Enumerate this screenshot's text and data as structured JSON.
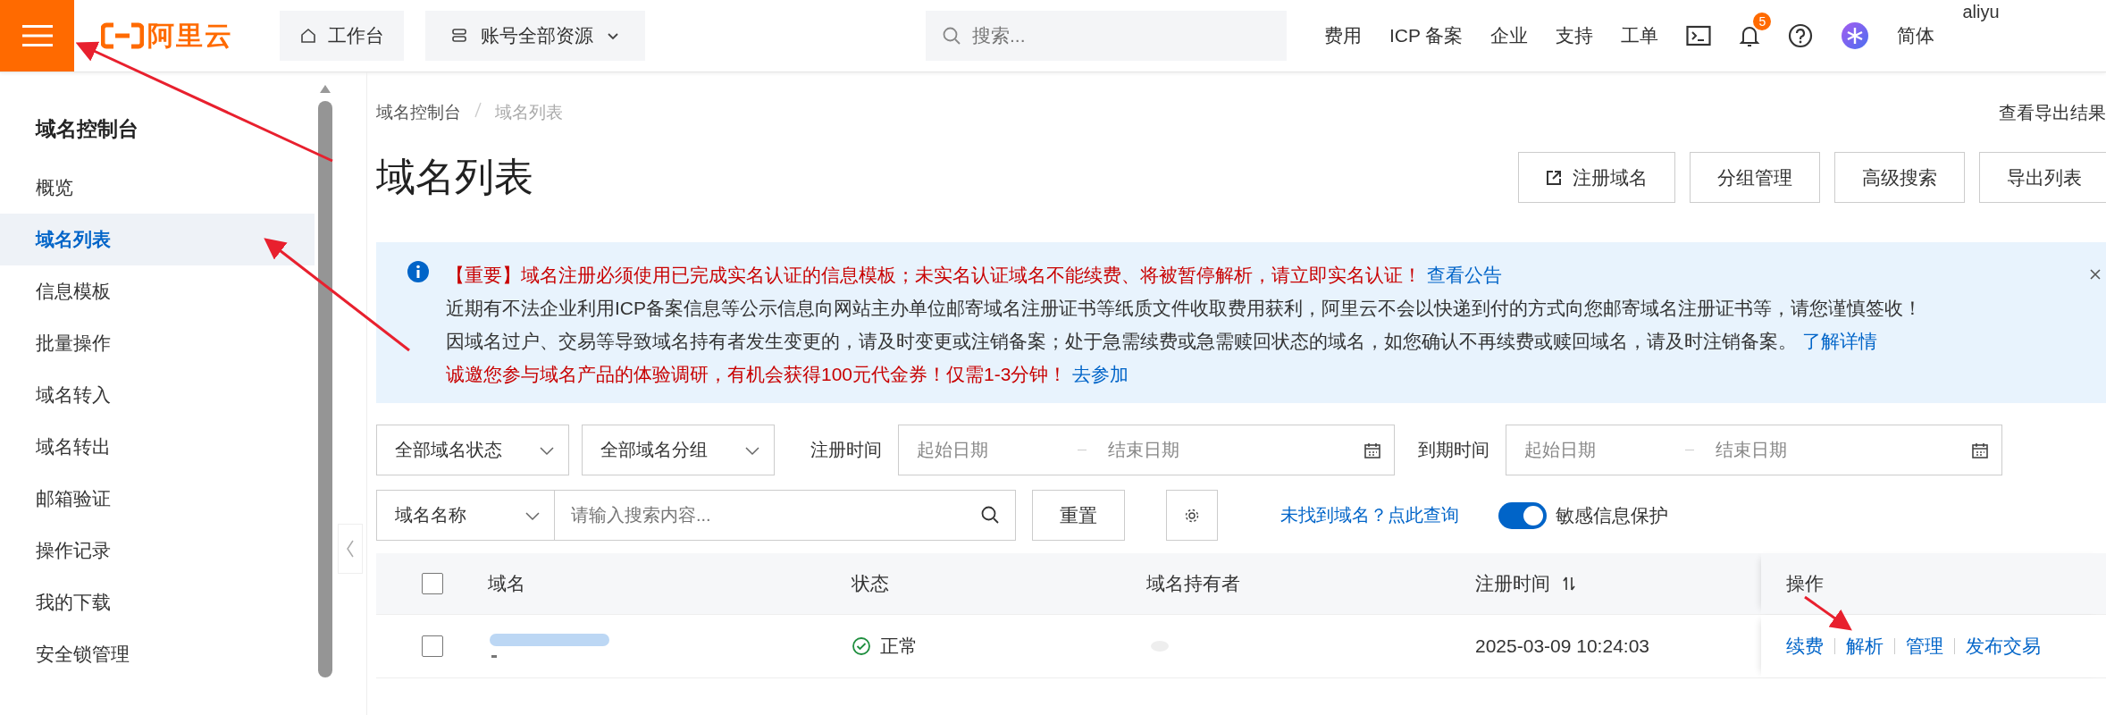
{
  "topbar": {
    "logo": "阿里云",
    "workbench": "工作台",
    "resource_selector": "账号全部资源",
    "search": {
      "placeholder": "搜索..."
    },
    "nav_links": [
      "费用",
      "ICP 备案",
      "企业",
      "支持",
      "工单"
    ],
    "notification_count": "5",
    "language": "简体",
    "user": "aliyu"
  },
  "sidebar": {
    "title": "域名控制台",
    "items": [
      {
        "label": "概览",
        "selected": false
      },
      {
        "label": "域名列表",
        "selected": true
      },
      {
        "label": "信息模板",
        "selected": false
      },
      {
        "label": "批量操作",
        "selected": false
      },
      {
        "label": "域名转入",
        "selected": false
      },
      {
        "label": "域名转出",
        "selected": false
      },
      {
        "label": "邮箱验证",
        "selected": false
      },
      {
        "label": "操作记录",
        "selected": false
      },
      {
        "label": "我的下载",
        "selected": false
      },
      {
        "label": "安全锁管理",
        "selected": false
      }
    ]
  },
  "breadcrumb": [
    "域名控制台",
    "域名列表"
  ],
  "export_results_link": "查看导出结果",
  "page_title": "域名列表",
  "actions": [
    {
      "label": "注册域名",
      "external": true
    },
    {
      "label": "分组管理",
      "external": false
    },
    {
      "label": "高级搜索",
      "external": false
    },
    {
      "label": "导出列表",
      "external": false
    }
  ],
  "notice": {
    "lines": [
      {
        "kind": "alert",
        "text": "【重要】域名注册必须使用已完成实名认证的信息模板；未实名认证域名不能续费、将被暂停解析，请立即实名认证！",
        "link": "查看公告"
      },
      {
        "kind": "plain",
        "text": "近期有不法企业利用ICP备案信息等公示信息向网站主办单位邮寄域名注册证书等纸质文件收取费用获利，阿里云不会以快递到付的方式向您邮寄域名注册证书等，请您谨慎签收！"
      },
      {
        "kind": "plain",
        "text": "因域名过户、交易等导致域名持有者发生变更的，请及时变更或注销备案；处于急需续费或急需赎回状态的域名，如您确认不再续费或赎回域名，请及时注销备案。",
        "link": "了解详情"
      },
      {
        "kind": "alert",
        "text": "诚邀您参与域名产品的体验调研，有机会获得100元代金券！仅需1-3分钟！",
        "link": "去参加"
      }
    ]
  },
  "filters": {
    "status_select": "全部域名状态",
    "group_select": "全部域名分组",
    "registration_time": {
      "label": "注册时间",
      "start_placeholder": "起始日期",
      "end_placeholder": "结束日期"
    },
    "expiry_time": {
      "label": "到期时间",
      "start_placeholder": "起始日期",
      "end_placeholder": "结束日期"
    },
    "search_field_select": "域名名称",
    "search": {
      "placeholder": "请输入搜索内容..."
    },
    "reset_button": "重置",
    "not_found_link": "未找到域名？点此查询",
    "sensitive_info_toggle": {
      "label": "敏感信息保护",
      "on": true
    }
  },
  "table": {
    "header_checked": false,
    "columns": [
      {
        "label": "域名",
        "sortable": false
      },
      {
        "label": "状态",
        "sortable": false
      },
      {
        "label": "域名持有者",
        "sortable": false
      },
      {
        "label": "注册时间",
        "sortable": true
      },
      {
        "label": "操作",
        "sortable": false
      }
    ],
    "rows": [
      {
        "checked": false,
        "status": "正常",
        "registered": "2025-03-09 10:24:03",
        "actions": [
          "续费",
          "解析",
          "管理",
          "发布交易"
        ]
      }
    ]
  }
}
